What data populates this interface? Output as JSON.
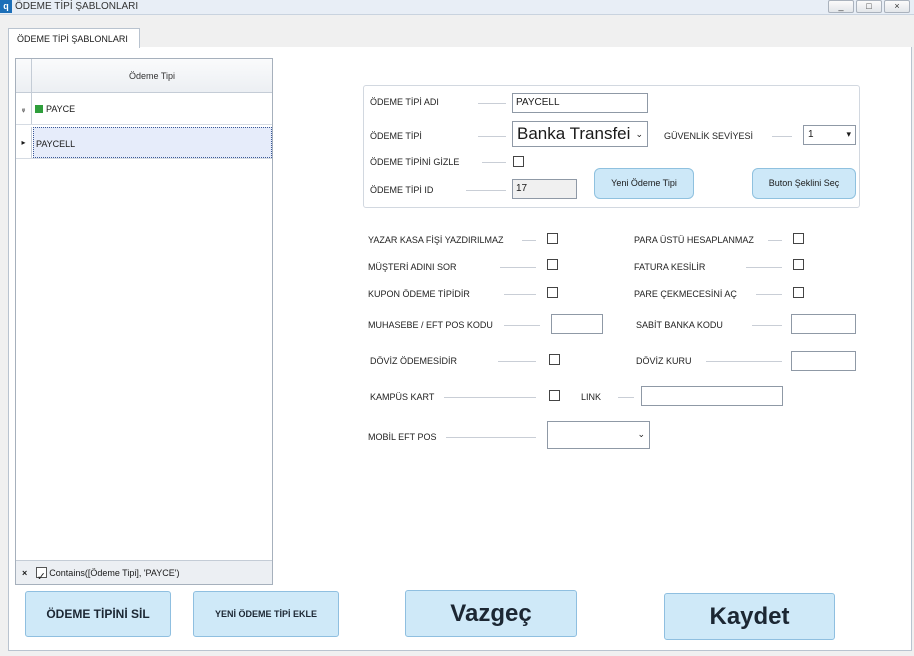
{
  "window": {
    "title": "ÖDEME TİPİ ŞABLONLARI",
    "icon_text": "q",
    "controls": [
      "_",
      "□",
      "×"
    ]
  },
  "tab": {
    "label": "ÖDEME TİPİ ŞABLONLARI"
  },
  "grid": {
    "column_header": "Ödeme Tipi",
    "filter_row": {
      "marker": "ᵩ",
      "value": "PAYCE"
    },
    "rows": [
      {
        "marker": "▸",
        "value": "PAYCELL"
      }
    ],
    "footer": {
      "close": "×",
      "filter_text": "Contains([Ödeme Tipi], 'PAYCE')",
      "filter_enabled": true
    }
  },
  "form": {
    "odeme_tipi_adi": {
      "label": "ÖDEME TİPİ ADI",
      "value": "PAYCELL"
    },
    "odeme_tipi": {
      "label": "ÖDEME TİPİ",
      "value": "Banka Transfei"
    },
    "guvenlik_seviyesi": {
      "label": "GÜVENLİK SEVİYESİ",
      "value": "1"
    },
    "odeme_tipini_gizle": {
      "label": "ÖDEME TİPİNİ GİZLE",
      "checked": false
    },
    "odeme_tipi_id": {
      "label": "ÖDEME TİPİ ID",
      "value": "17"
    },
    "yeni_odeme_tipi_button": "Yeni Ödeme Tipi",
    "buton_seklini_sec_button": "Buton Şeklini Seç",
    "yazar_kasa": {
      "label": "YAZAR KASA FİŞİ YAZDIRILMAZ",
      "checked": false
    },
    "para_ustu": {
      "label": "PARA ÜSTÜ HESAPLANMAZ",
      "checked": false
    },
    "musteri_adini_sor": {
      "label": "MÜŞTERİ ADINI SOR",
      "checked": false
    },
    "fatura_kesilir": {
      "label": "FATURA KESİLİR",
      "checked": false
    },
    "kupon_odeme_tipidir": {
      "label": "KUPON ÖDEME TİPİDİR",
      "checked": false
    },
    "pare_cekmecesini_ac": {
      "label": "PARE ÇEKMECESİNİ AÇ",
      "checked": false
    },
    "muhasebe_kodu": {
      "label": "MUHASEBE / EFT POS KODU",
      "value": ""
    },
    "sabit_banka_kodu": {
      "label": "SABİT BANKA KODU",
      "value": ""
    },
    "doviz_odemesidir": {
      "label": "DÖVİZ ÖDEMESİDİR",
      "checked": false
    },
    "doviz_kuru": {
      "label": "DÖVİZ KURU",
      "value": ""
    },
    "kampus_kart": {
      "label": "KAMPÜS KART",
      "checked": false
    },
    "link": {
      "label": "LINK",
      "value": ""
    },
    "mobil_eft_pos": {
      "label": "MOBİL EFT POS",
      "value": ""
    }
  },
  "actions": {
    "delete": "ÖDEME TİPİNİ SİL",
    "add": "YENİ ÖDEME TİPİ EKLE",
    "cancel": "Vazgeç",
    "save": "Kaydet"
  }
}
